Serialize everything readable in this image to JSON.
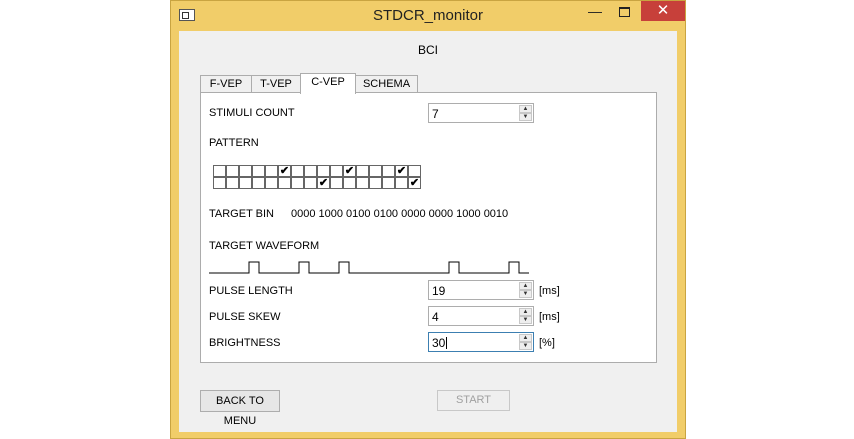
{
  "window": {
    "title": "STDCR_monitor",
    "icons": {
      "app": "app-window-icon",
      "minimize": "minimize-icon",
      "maximize": "maximize-icon",
      "close": "close-icon"
    },
    "glyphs": {
      "minimize": "—",
      "close": "✕"
    }
  },
  "header": {
    "title": "BCI"
  },
  "tabs": [
    {
      "label": "F-VEP",
      "active": false
    },
    {
      "label": "T-VEP",
      "active": false
    },
    {
      "label": "C-VEP",
      "active": true
    },
    {
      "label": "SCHEMA",
      "active": false
    }
  ],
  "form": {
    "stimuli_count": {
      "label": "STIMULI COUNT",
      "value": "7"
    },
    "pattern": {
      "label": "PATTERN",
      "rows": [
        [
          0,
          0,
          0,
          0,
          0,
          1,
          0,
          0,
          0,
          0,
          1,
          0,
          0,
          0,
          1,
          0
        ],
        [
          0,
          0,
          0,
          0,
          0,
          0,
          0,
          0,
          1,
          0,
          0,
          0,
          0,
          0,
          0,
          1
        ]
      ],
      "check_glyph": "✔"
    },
    "target_bin": {
      "label": "TARGET BIN",
      "value": "0000 1000 0100 0100 0000 0000 1000 0010"
    },
    "target_waveform": {
      "label": "TARGET WAVEFORM",
      "bits": "00001000010001000000000010000010"
    },
    "pulse_length": {
      "label": "PULSE LENGTH",
      "value": "19",
      "unit": "[ms]"
    },
    "pulse_skew": {
      "label": "PULSE SKEW",
      "value": "4",
      "unit": "[ms]"
    },
    "brightness": {
      "label": "BRIGHTNESS",
      "value": "30",
      "unit": "[%]"
    },
    "spin_glyphs": {
      "up": "▲",
      "down": "▼"
    }
  },
  "footer": {
    "back_label": "BACK TO MENU",
    "start_label": "START",
    "start_enabled": false
  },
  "colors": {
    "titlebar": "#f1cd69",
    "close_button": "#c7403a",
    "panel": "#ffffff",
    "client": "#f0f0f0"
  }
}
